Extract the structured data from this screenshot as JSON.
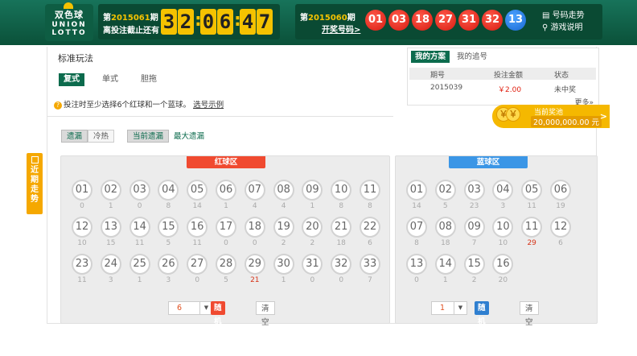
{
  "logo": {
    "cn": "双色球",
    "en1": "UNION",
    "en2": "LOTTO"
  },
  "countdown": {
    "prefix": "第",
    "issue": "2015061",
    "suffix": "期",
    "label2": "离投注截止还有",
    "digits": [
      "3",
      "2",
      "0",
      "6",
      "4",
      "7"
    ],
    "sep": ":"
  },
  "lottery": {
    "prefix": "第",
    "issue": "2015060",
    "suffix": "期",
    "link": "开奖号码>",
    "balls": [
      "01",
      "03",
      "18",
      "27",
      "31",
      "32"
    ],
    "blue_ball": "13",
    "link1": "号码走势",
    "link2": "游戏说明",
    "link1_icon": "chart-icon",
    "link2_icon": "location-icon"
  },
  "sidebar": {
    "label": [
      "近",
      "期",
      "走",
      "势"
    ]
  },
  "main": {
    "title": "标准玩法",
    "modes": [
      "复式",
      "单式",
      "胆拖"
    ],
    "hint": "投注时至少选择6个红球和一个蓝球。",
    "hint_link": "选号示例"
  },
  "tabs": {
    "omit": "遗漏",
    "hot": "冷热",
    "current_omit": "当前遗漏",
    "max_omit": "最大遗漏"
  },
  "plan": {
    "tab1": "我的方案",
    "tab2": "我的追号",
    "headers": [
      "期号",
      "投注金额",
      "状态"
    ],
    "rows": [
      [
        "2015039",
        "￥2.00",
        "未中奖"
      ]
    ],
    "more": "更多»"
  },
  "prize": {
    "label": "当前奖池",
    "amount": "20,000,000.00 元",
    "arrow": ">",
    "coin": "￥"
  },
  "red_area": {
    "title": "红球区",
    "balls": [
      [
        "01",
        "0"
      ],
      [
        "02",
        "1"
      ],
      [
        "03",
        "0"
      ],
      [
        "04",
        "8"
      ],
      [
        "05",
        "14"
      ],
      [
        "06",
        "1"
      ],
      [
        "07",
        "4"
      ],
      [
        "08",
        "4"
      ],
      [
        "09",
        "1"
      ],
      [
        "10",
        "8"
      ],
      [
        "11",
        "8"
      ],
      [
        "12",
        "10"
      ],
      [
        "13",
        "15"
      ],
      [
        "14",
        "11"
      ],
      [
        "15",
        "5"
      ],
      [
        "16",
        "11"
      ],
      [
        "17",
        "0"
      ],
      [
        "18",
        "0"
      ],
      [
        "19",
        "2"
      ],
      [
        "20",
        "2"
      ],
      [
        "21",
        "18"
      ],
      [
        "22",
        "6"
      ],
      [
        "23",
        "11"
      ],
      [
        "24",
        "3"
      ],
      [
        "25",
        "1"
      ],
      [
        "26",
        "3"
      ],
      [
        "27",
        "0"
      ],
      [
        "28",
        "5"
      ],
      [
        "29",
        "21"
      ],
      [
        "30",
        "1"
      ],
      [
        "31",
        "0"
      ],
      [
        "32",
        "0"
      ],
      [
        "33",
        "7"
      ]
    ],
    "count": "6",
    "random": "随机红球",
    "clear": "清空"
  },
  "blue_area": {
    "title": "蓝球区",
    "balls": [
      [
        "01",
        "14"
      ],
      [
        "02",
        "5"
      ],
      [
        "03",
        "23"
      ],
      [
        "04",
        "3"
      ],
      [
        "05",
        "11"
      ],
      [
        "06",
        "19"
      ],
      [
        "07",
        "8"
      ],
      [
        "08",
        "18"
      ],
      [
        "09",
        "7"
      ],
      [
        "10",
        "10"
      ],
      [
        "11",
        "29"
      ],
      [
        "12",
        "6"
      ],
      [
        "13",
        "0"
      ],
      [
        "14",
        "1"
      ],
      [
        "15",
        "2"
      ],
      [
        "16",
        "20"
      ]
    ],
    "count": "1",
    "random": "随机蓝球",
    "clear": "清空"
  },
  "colors": {
    "green": "#0c6b4d",
    "red": "#f04a30",
    "blue": "#3b96e6",
    "yellow": "#f5c200",
    "orange": "#f5a800"
  }
}
